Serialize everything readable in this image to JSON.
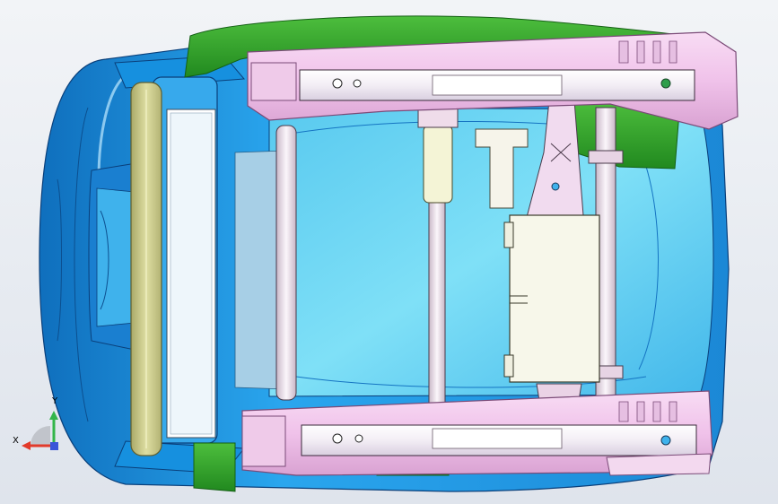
{
  "viewport": {
    "background": "#e7ebf1",
    "part_colors": {
      "cushion_pan": "#1f9fe6",
      "seat_foam": "#6fd6f2",
      "track_rail": "#f1c6ec",
      "track_rail_edge": "#7a4a77",
      "green_trim": "#2fa52a",
      "front_bar": "#cfcf8e",
      "motor_housing": "#f6f6e8",
      "frame_member": "#f4e7f1"
    }
  },
  "triad": {
    "x_label": "X",
    "y_label": "Y",
    "x_color": "#e23a2a",
    "y_color": "#33b54a",
    "z_color": "#3a55d8"
  }
}
